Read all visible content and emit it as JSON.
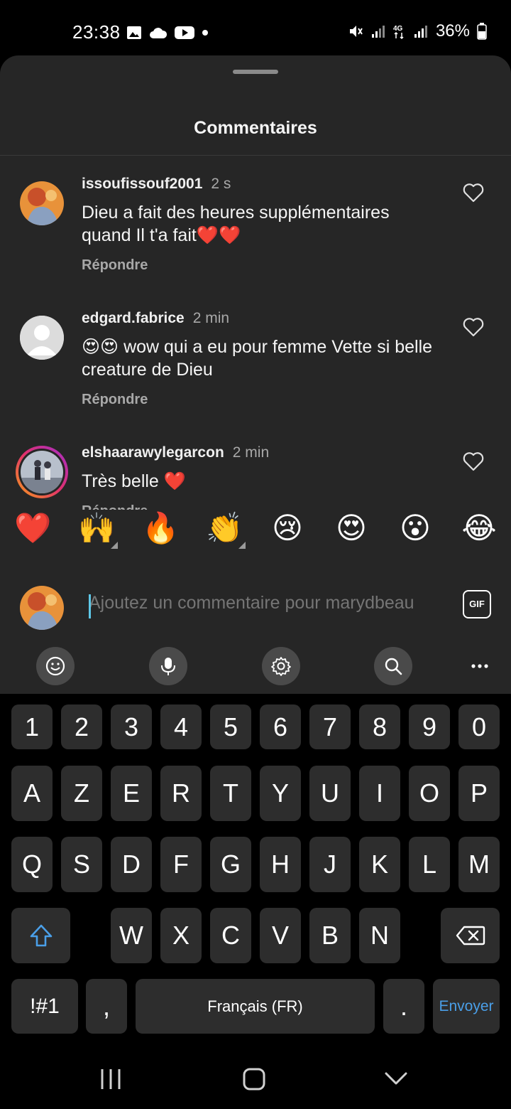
{
  "status_bar": {
    "time": "23:38",
    "battery": "36%"
  },
  "sheet": {
    "title": "Commentaires"
  },
  "comments": [
    {
      "user": "issoufissouf2001",
      "time": "2 s",
      "text": "Dieu a fait des heures supplémentaires quand Il t'a fait❤️❤️",
      "reply": "Répondre"
    },
    {
      "user": "edgard.fabrice",
      "time": "2 min",
      "text": "😍😍 wow qui a eu pour femme Vette si belle creature de Dieu",
      "reply": "Répondre"
    },
    {
      "user": "elshaarawylegarcon",
      "time": "2 min",
      "text": "Très belle ❤️",
      "reply": "Répondre"
    }
  ],
  "quick_emojis": [
    "❤️",
    "🙌",
    "🔥",
    "👏",
    "😢",
    "😍",
    "😮",
    "😂"
  ],
  "comment_input": {
    "placeholder": "Ajoutez un commentaire pour marydbeau",
    "gif_label": "GIF"
  },
  "keyboard": {
    "row_numbers": [
      "1",
      "2",
      "3",
      "4",
      "5",
      "6",
      "7",
      "8",
      "9",
      "0"
    ],
    "row1": [
      "A",
      "Z",
      "E",
      "R",
      "T",
      "Y",
      "U",
      "I",
      "O",
      "P"
    ],
    "row2": [
      "Q",
      "S",
      "D",
      "F",
      "G",
      "H",
      "J",
      "K",
      "L",
      "M"
    ],
    "row3": [
      "W",
      "X",
      "C",
      "V",
      "B",
      "N"
    ],
    "symbols_label": "!#1",
    "comma": ",",
    "space_label": "Français (FR)",
    "period": ".",
    "send_label": "Envoyer"
  },
  "colors": {
    "accent": "#5ec8e8",
    "send": "#4a9fe8",
    "sheet_bg": "#262626"
  }
}
